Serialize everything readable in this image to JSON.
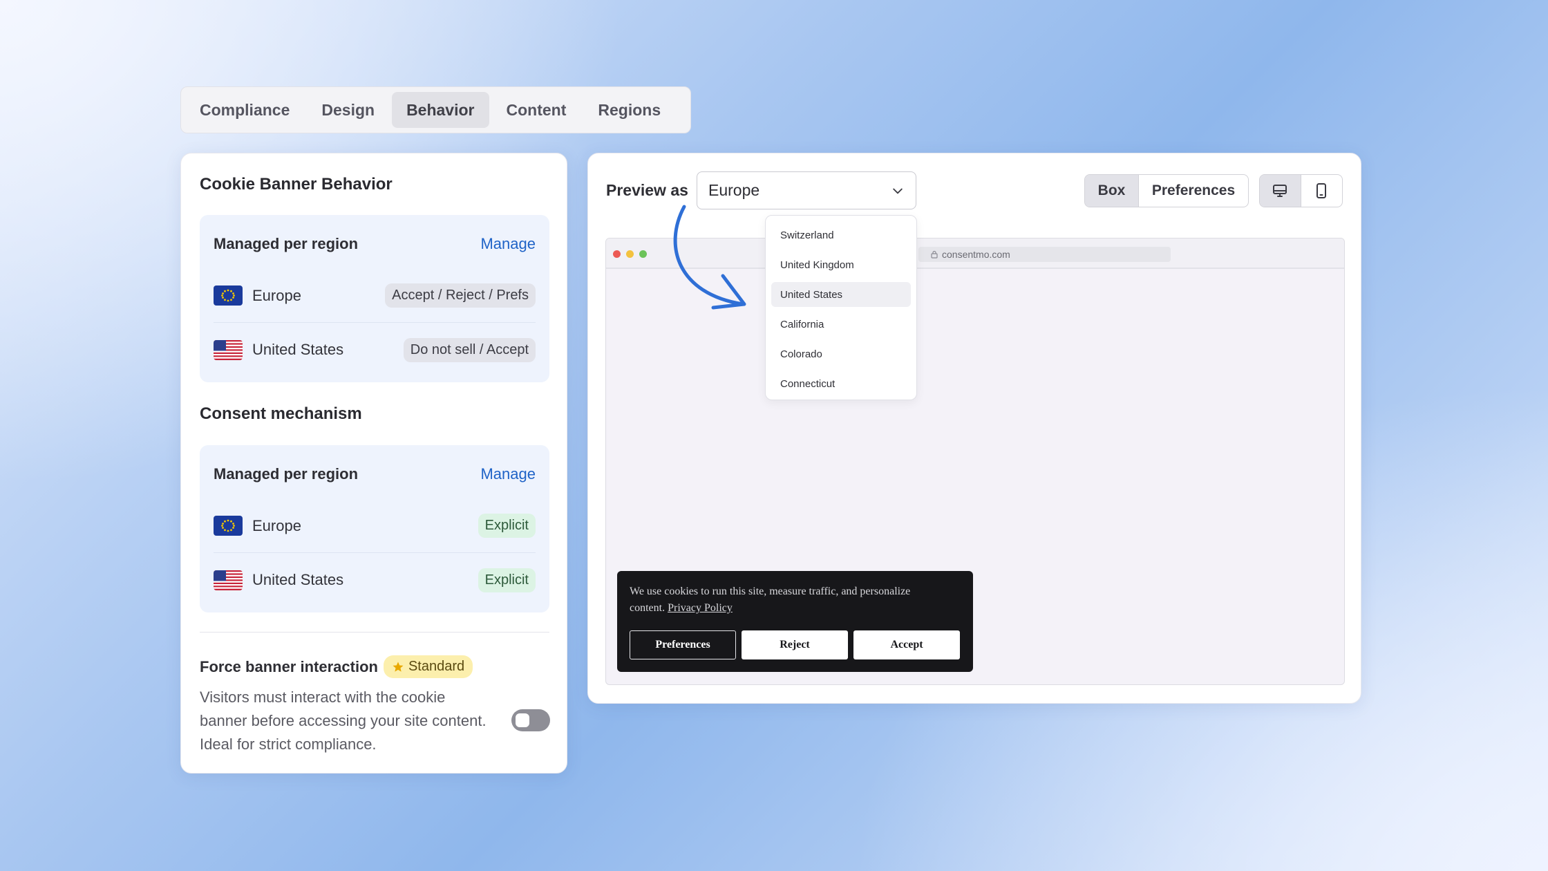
{
  "tabs": [
    {
      "label": "Compliance"
    },
    {
      "label": "Design"
    },
    {
      "label": "Behavior"
    },
    {
      "label": "Content"
    },
    {
      "label": "Regions"
    }
  ],
  "active_tab": "Behavior",
  "behavior": {
    "title": "Cookie Banner Behavior",
    "managed_label": "Managed per region",
    "manage_link": "Manage",
    "rows": [
      {
        "region": "Europe",
        "flag": "eu-flag-icon",
        "value": "Accept / Reject / Prefs"
      },
      {
        "region": "United States",
        "flag": "us-flag-icon",
        "value": "Do not sell / Accept"
      }
    ]
  },
  "consent": {
    "title": "Consent mechanism",
    "managed_label": "Managed per region",
    "manage_link": "Manage",
    "rows": [
      {
        "region": "Europe",
        "flag": "eu-flag-icon",
        "value": "Explicit"
      },
      {
        "region": "United States",
        "flag": "us-flag-icon",
        "value": "Explicit"
      }
    ]
  },
  "force": {
    "title": "Force banner interaction",
    "badge": "Standard",
    "description": "Visitors must interact with the cookie banner before accessing your site content. Ideal for strict compliance.",
    "enabled": false
  },
  "preview": {
    "label": "Preview as",
    "selected": "Europe",
    "view_modes": [
      "Box",
      "Preferences"
    ],
    "active_view": "Box",
    "devices": [
      "desktop-icon",
      "mobile-icon"
    ],
    "active_device": "desktop-icon",
    "url": "consentmo.com"
  },
  "dropdown": {
    "options": [
      "Switzerland",
      "United Kingdom",
      "United States",
      "California",
      "Colorado",
      "Connecticut"
    ],
    "highlighted": "United States"
  },
  "banner": {
    "text": "We use cookies to run this site, measure traffic, and personalize content.",
    "link": "Privacy Policy",
    "buttons": [
      "Preferences",
      "Reject",
      "Accept"
    ]
  },
  "colors": {
    "accent_link": "#1f63c7",
    "arrow": "#2f6fd6",
    "badge_bg": "#fcefad",
    "explicit_bg": "#dcf3e4",
    "banner_bg": "#17171a"
  }
}
